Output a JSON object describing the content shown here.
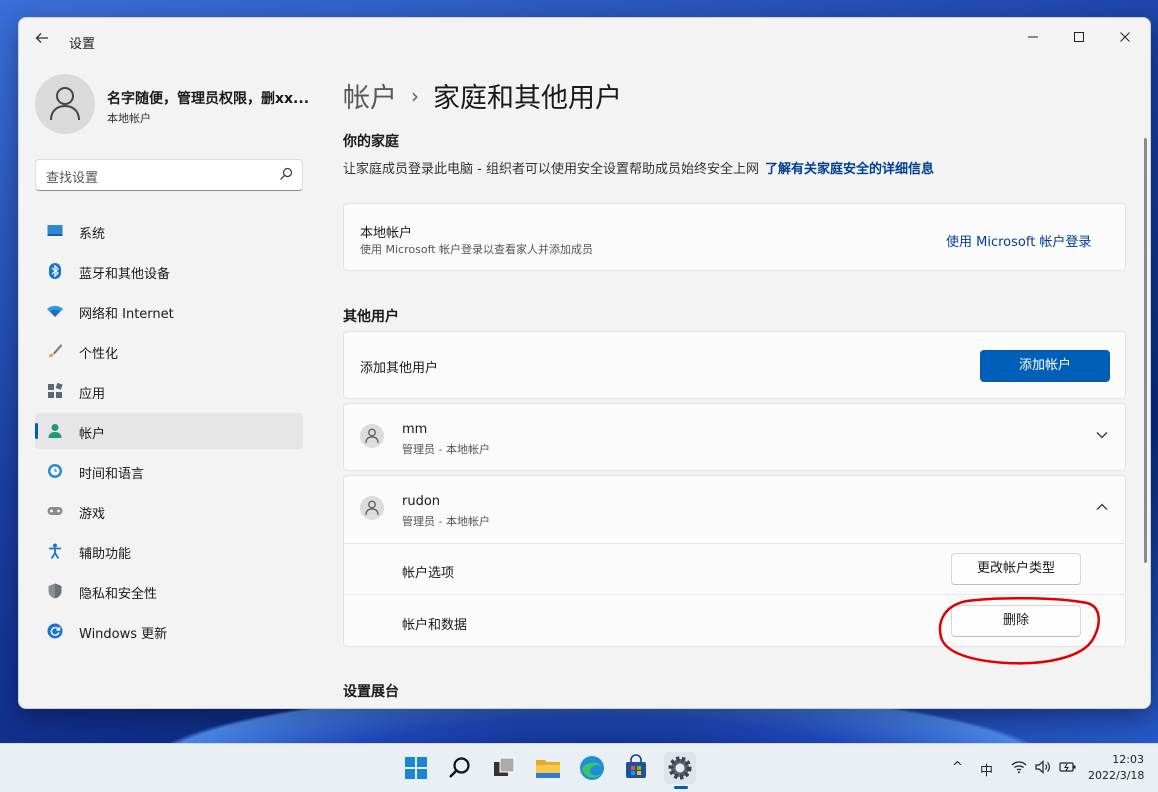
{
  "window": {
    "app_title": "设置",
    "controls": {
      "minimize": "—",
      "maximize": "☐",
      "close": "✕"
    }
  },
  "profile": {
    "name": "名字随便，管理员权限，删xx...",
    "subtitle": "本地帐户"
  },
  "search": {
    "placeholder": "查找设置"
  },
  "sidebar": {
    "items": [
      {
        "label": "系统",
        "icon": "monitor-icon"
      },
      {
        "label": "蓝牙和其他设备",
        "icon": "bluetooth-icon"
      },
      {
        "label": "网络和 Internet",
        "icon": "wifi-icon"
      },
      {
        "label": "个性化",
        "icon": "brush-icon"
      },
      {
        "label": "应用",
        "icon": "apps-icon"
      },
      {
        "label": "帐户",
        "icon": "person-icon",
        "active": true
      },
      {
        "label": "时间和语言",
        "icon": "globe-clock-icon"
      },
      {
        "label": "游戏",
        "icon": "gamepad-icon"
      },
      {
        "label": "辅助功能",
        "icon": "accessibility-icon"
      },
      {
        "label": "隐私和安全性",
        "icon": "shield-icon"
      },
      {
        "label": "Windows 更新",
        "icon": "update-icon"
      }
    ]
  },
  "breadcrumb": {
    "parent": "帐户",
    "separator": "›",
    "current": "家庭和其他用户"
  },
  "family": {
    "heading": "你的家庭",
    "description": "让家庭成员登录此电脑 - 组织者可以使用安全设置帮助成员始终安全上网",
    "link": "了解有关家庭安全的详细信息",
    "local_card": {
      "title": "本地帐户",
      "subtitle": "使用 Microsoft 帐户登录以查看家人并添加成员",
      "action": "使用 Microsoft 帐户登录"
    }
  },
  "other_users": {
    "heading": "其他用户",
    "add_label": "添加其他用户",
    "add_button": "添加帐户",
    "users": [
      {
        "name": "mm",
        "role": "管理员 - 本地帐户",
        "expanded": false
      },
      {
        "name": "rudon",
        "role": "管理员 - 本地帐户",
        "expanded": true
      }
    ],
    "expanded": {
      "options_label": "帐户选项",
      "options_button": "更改帐户类型",
      "data_label": "帐户和数据",
      "delete_button": "删除"
    }
  },
  "kiosk": {
    "heading": "设置展台"
  },
  "taskbar": {
    "apps": [
      "start-icon",
      "search-icon",
      "task-view-icon",
      "file-explorer-icon",
      "edge-icon",
      "store-icon",
      "settings-icon"
    ],
    "tray": {
      "chevron": "^",
      "ime": "中"
    },
    "time": "12:03",
    "date": "2022/3/18"
  },
  "colors": {
    "accent": "#005fb8",
    "link": "#003e92",
    "annotation": "#e00000"
  }
}
